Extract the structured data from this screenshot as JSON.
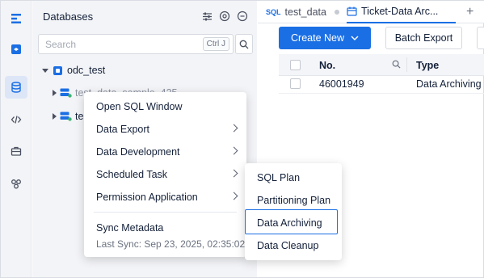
{
  "sidebar": {
    "title": "Databases",
    "search_placeholder": "Search",
    "shortcut": "Ctrl J",
    "tree": {
      "root": "odc_test",
      "child1": "test_data_sample_425",
      "child2": "te"
    }
  },
  "tabs": [
    {
      "tag": "SQL",
      "label": "test_data"
    },
    {
      "label": "Ticket-Data Arc..."
    }
  ],
  "toolbar": {
    "create_new": "Create New",
    "batch_export": "Batch Export"
  },
  "table": {
    "headers": [
      "No.",
      "Type"
    ],
    "rows": [
      {
        "no": "46001949",
        "type": "Data Archiving"
      }
    ]
  },
  "context_menu": {
    "items": [
      "Open SQL Window",
      "Data Export",
      "Data Development",
      "Scheduled Task",
      "Permission Application"
    ],
    "sync_label": "Sync Metadata",
    "last_sync": "Last Sync: Sep 23, 2025, 02:35:02"
  },
  "submenu": {
    "items": [
      "SQL Plan",
      "Partitioning Plan",
      "Data Archiving",
      "Data Cleanup"
    ],
    "highlighted": "Data Archiving"
  },
  "colors": {
    "accent": "#1b6fe4",
    "panel_bg": "#f3f4f7"
  }
}
